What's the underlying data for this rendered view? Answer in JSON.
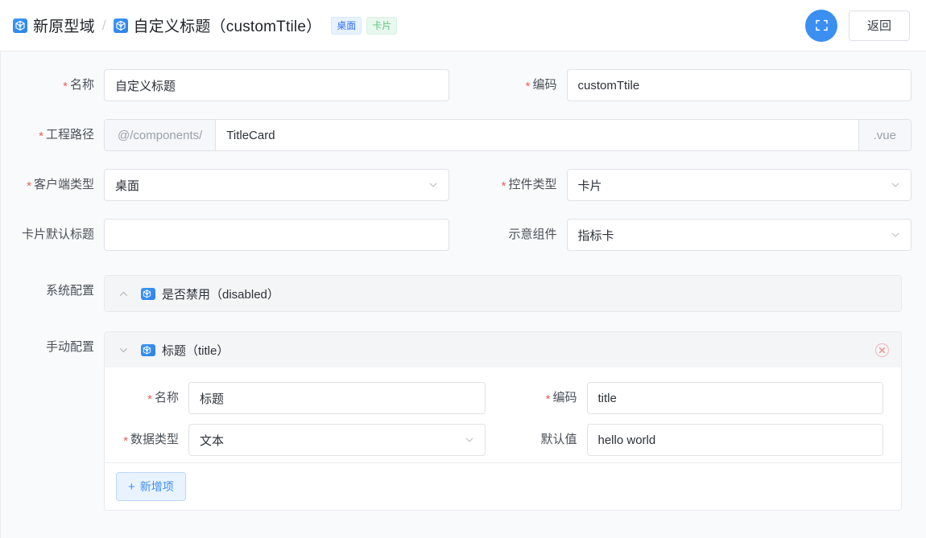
{
  "header": {
    "breadcrumb": [
      {
        "icon": "prototype-domain-icon",
        "label": "新原型域"
      },
      {
        "icon": "prototype-domain-icon",
        "label": "自定义标题（customTtile）"
      }
    ],
    "separator": "/",
    "tags": [
      {
        "label": "桌面",
        "color": "#3370ff"
      },
      {
        "label": "卡片",
        "color": "#5fc47e"
      }
    ],
    "fullscreen_button": {
      "icon": "fullscreen-icon",
      "color": "#3a8ff0"
    },
    "back_button": "返回"
  },
  "form": {
    "name": {
      "label": "名称",
      "required": true,
      "value": "自定义标题"
    },
    "code": {
      "label": "编码",
      "required": true,
      "value": "customTtile"
    },
    "project_path": {
      "label": "工程路径",
      "required": true,
      "prefix": "@/components/",
      "value": "TitleCard",
      "suffix": ".vue"
    },
    "client_type": {
      "label": "客户端类型",
      "required": true,
      "value": "桌面"
    },
    "widget_type": {
      "label": "控件类型",
      "required": true,
      "value": "卡片"
    },
    "card_default_title": {
      "label": "卡片默认标题",
      "required": false,
      "value": "",
      "placeholder": ""
    },
    "demo_component": {
      "label": "示意组件",
      "required": false,
      "value": "指标卡"
    },
    "system_config": {
      "label": "系统配置",
      "panels": [
        {
          "title": "是否禁用（disabled）",
          "expanded": false,
          "icon": "prototype-domain-icon"
        }
      ]
    },
    "manual_config": {
      "label": "手动配置",
      "panels": [
        {
          "title": "标题（title）",
          "expanded": true,
          "icon": "prototype-domain-icon",
          "delete_icon": "circle-close-icon",
          "fields": {
            "name": {
              "label": "名称",
              "required": true,
              "value": "标题"
            },
            "code": {
              "label": "编码",
              "required": true,
              "value": "title"
            },
            "data_type": {
              "label": "数据类型",
              "required": true,
              "value": "文本"
            },
            "default_value": {
              "label": "默认值",
              "required": false,
              "value": "hello world"
            }
          }
        }
      ],
      "add_button": {
        "label": "新增项",
        "plus": "+"
      }
    }
  }
}
